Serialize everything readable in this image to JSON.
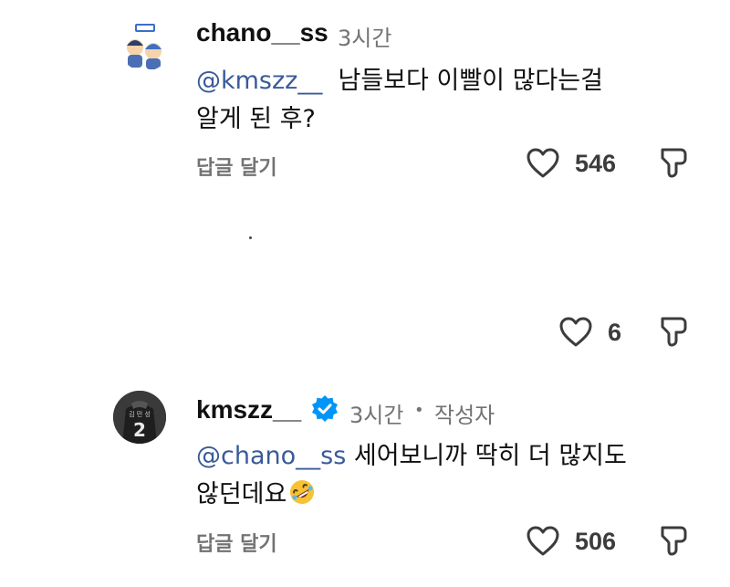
{
  "comments": [
    {
      "username": "chano__ss",
      "time": "3시간",
      "mention": "@kmszz__",
      "text_line1": "남들보다 이빨이 많다는걸",
      "text_line2": "알게 된 후?",
      "reply_label": "답글 달기",
      "likes": "546"
    },
    {
      "likes": "6"
    },
    {
      "username": "kmszz__",
      "verified": true,
      "time": "3시간",
      "separator": "•",
      "author_badge": "작성자",
      "mention": "@chano__ss",
      "text_line1": "세어보니까 딱히 더 많지도",
      "text_line2": "않던데요",
      "emoji": "🤣",
      "reply_label": "답글 달기",
      "likes": "506"
    }
  ],
  "icons": {
    "like": "heart-outline-icon",
    "dislike": "thumbs-down-outline-icon",
    "verified": "verified-badge-icon"
  },
  "colors": {
    "mention": "#3a5a9a",
    "meta": "#737373",
    "verified": "#0095f6"
  }
}
